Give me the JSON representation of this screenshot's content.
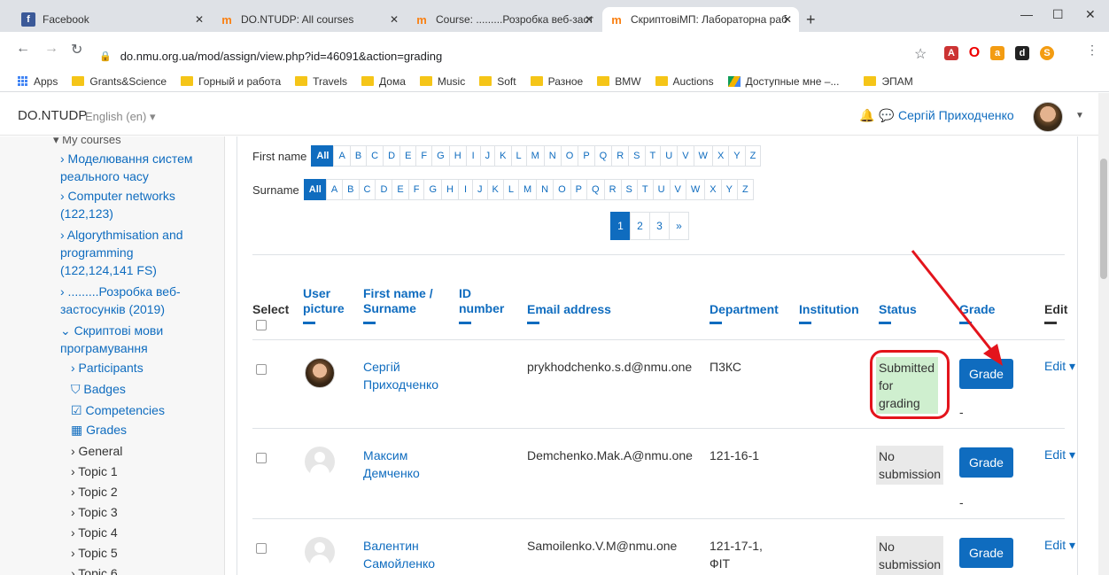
{
  "browser": {
    "tabs": [
      {
        "title": "Facebook",
        "icon": "facebook-icon"
      },
      {
        "title": "DO.NTUDP: All courses",
        "icon": "moodle-icon"
      },
      {
        "title": "Course: .........Розробка веб-застосу",
        "icon": "moodle-icon"
      },
      {
        "title": "СкриптовіМП: Лабораторна раб",
        "icon": "moodle-icon",
        "active": true
      }
    ],
    "url": "do.nmu.org.ua/mod/assign/view.php?id=46091&action=grading",
    "bookmarks": [
      "Apps",
      "Grants&Science",
      "Горный и работа",
      "Travels",
      "Дома",
      "Music",
      "Soft",
      "Разное",
      "BMW",
      "Auctions",
      "Доступные мне –...",
      "ЭПАМ"
    ]
  },
  "navbar": {
    "brand": "DO.NTUDP",
    "language": "English (en) ▾",
    "user_name": "Сергій Приходченко"
  },
  "sidebar": {
    "items": [
      "▾ My courses",
      "› Моделювання систем",
      "реального часу",
      "› Computer networks",
      "(122,123)",
      "› Algorythmisation and",
      "programming",
      "(122,124,141 FS)",
      "› .........Розробка веб-",
      "застосунків (2019)",
      "⌄ Скриптові мови",
      "програмування",
      "› Participants",
      "Badges",
      "Competencies",
      "Grades",
      "› General",
      "› Topic 1",
      "› Topic 2",
      "› Topic 3",
      "› Topic 4",
      "› Topic 5",
      "› Topic 6"
    ]
  },
  "filters": {
    "first_name_label": "First name",
    "surname_label": "Surname",
    "all": "All",
    "letters": [
      "A",
      "B",
      "C",
      "D",
      "E",
      "F",
      "G",
      "H",
      "I",
      "J",
      "K",
      "L",
      "M",
      "N",
      "O",
      "P",
      "Q",
      "R",
      "S",
      "T",
      "U",
      "V",
      "W",
      "X",
      "Y",
      "Z"
    ]
  },
  "pagination": [
    "1",
    "2",
    "3",
    "»"
  ],
  "table": {
    "headers": {
      "select": "Select",
      "user_picture": [
        "User",
        "picture"
      ],
      "name": [
        "First name /",
        "Surname"
      ],
      "id_number": [
        "ID",
        "number"
      ],
      "email": "Email address",
      "department": "Department",
      "institution": "Institution",
      "status": "Status",
      "grade": "Grade",
      "edit": "Edit"
    },
    "rows": [
      {
        "first": "Сергій",
        "last": "Приходченко",
        "email": "prykhodchenko.s.d@nmu.one",
        "dept": [
          "П3КС"
        ],
        "status": [
          "Submitted",
          "for",
          "grading"
        ],
        "grade_btn": "Grade",
        "edit": "Edit ▾",
        "grade_val": "-"
      },
      {
        "first": "Максим",
        "last": "Демченко",
        "email": "Demchenko.Mak.A@nmu.one",
        "dept": [
          "121-16-1"
        ],
        "status": [
          "No",
          "submission"
        ],
        "grade_btn": "Grade",
        "edit": "Edit ▾",
        "grade_val": "-"
      },
      {
        "first": "Валентин",
        "last": "Самойленко",
        "email": "Samoilenko.V.M@nmu.one",
        "dept": [
          "121-17-1,",
          "ФІТ"
        ],
        "status": [
          "No",
          "submission"
        ],
        "grade_btn": "Grade",
        "edit": "Edit ▾"
      }
    ]
  },
  "colors": {
    "link": "#0f6cbf",
    "highlight": "#e3141c",
    "submitted_bg": "#cfefcf"
  }
}
